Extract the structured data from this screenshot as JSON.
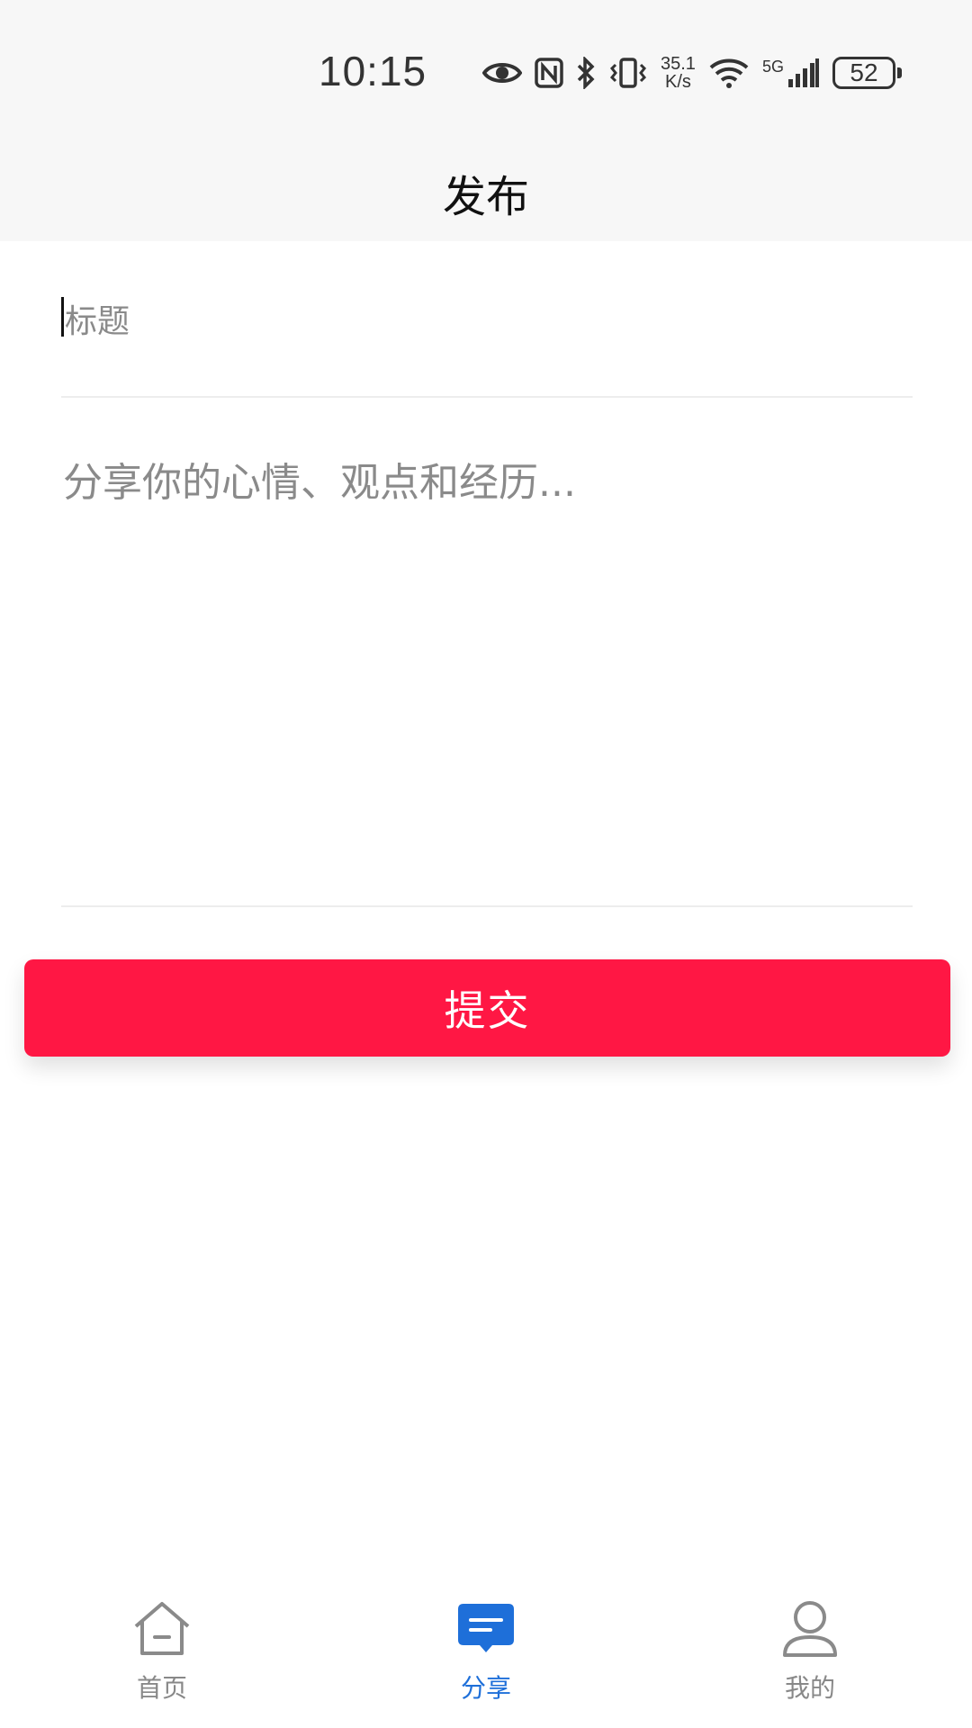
{
  "status_bar": {
    "time": "10:15",
    "net_speed_value": "35.1",
    "net_speed_unit": "K/s",
    "network_type": "5G",
    "battery": "52"
  },
  "header": {
    "title": "发布"
  },
  "form": {
    "title_placeholder": "标题",
    "content_placeholder": "分享你的心情、观点和经历..."
  },
  "submit": {
    "label": "提交",
    "color": "#ff1744"
  },
  "tabbar": {
    "active_color": "#1e6fd9",
    "items": [
      {
        "label": "首页",
        "icon": "home-icon"
      },
      {
        "label": "分享",
        "icon": "message-icon"
      },
      {
        "label": "我的",
        "icon": "user-icon"
      }
    ]
  }
}
